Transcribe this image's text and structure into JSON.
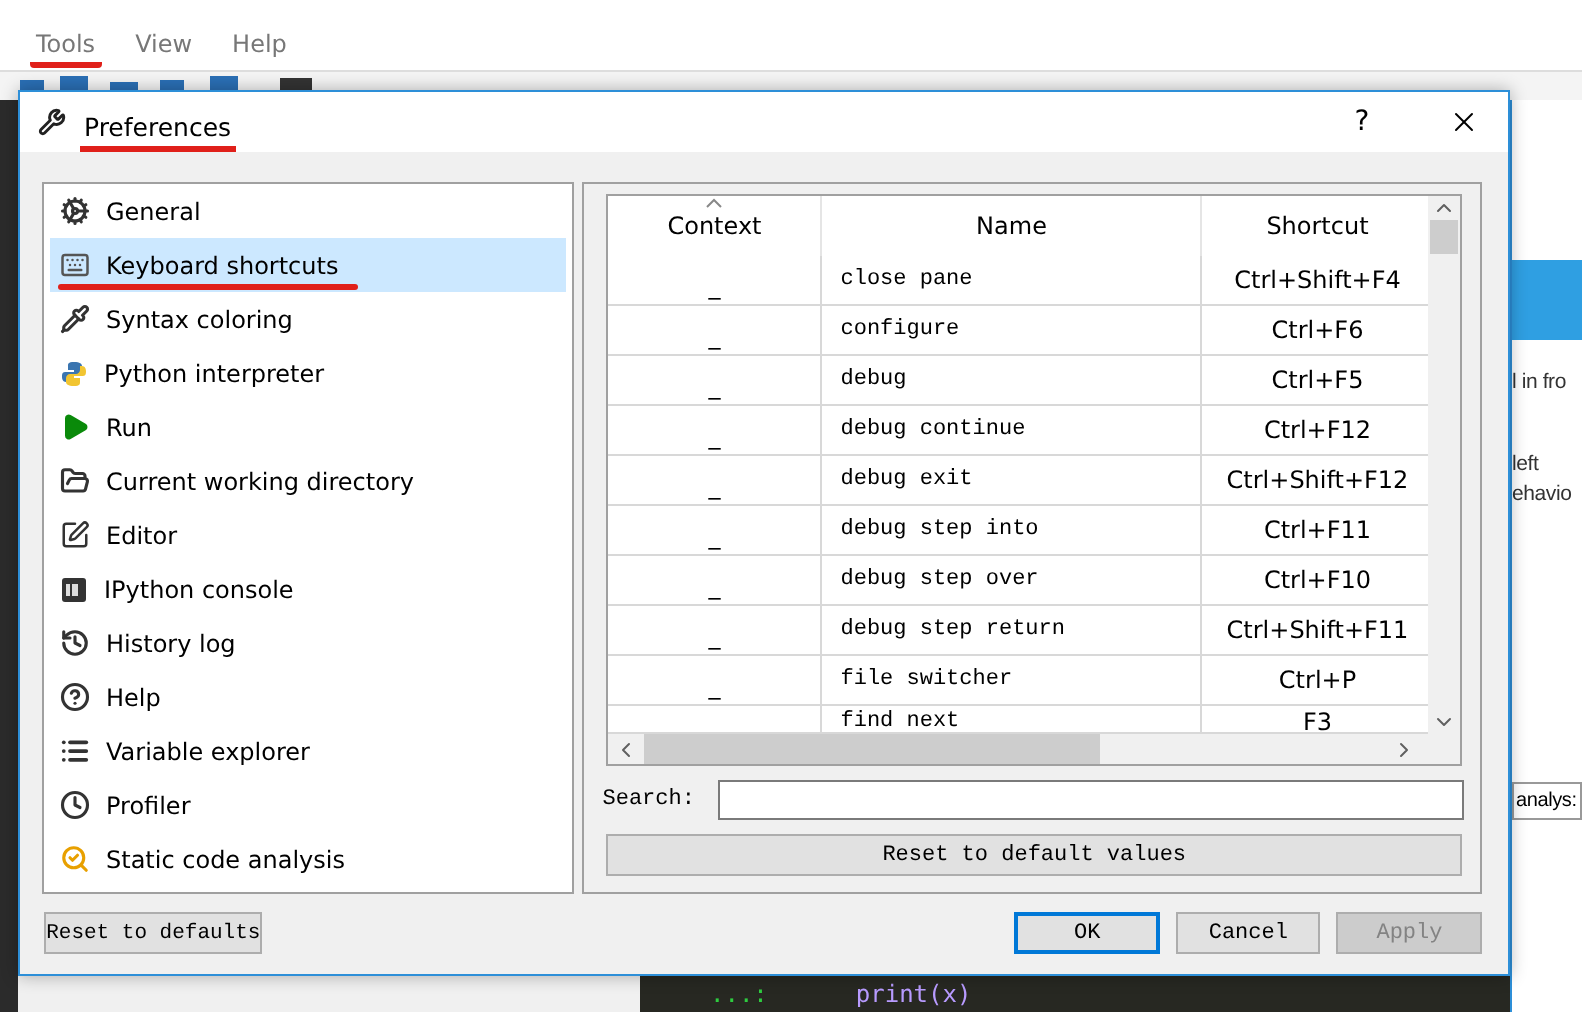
{
  "menu_bar": [
    {
      "label": "Tools",
      "annotated": true
    },
    {
      "label": "View",
      "annotated": false
    },
    {
      "label": "Help",
      "annotated": false
    }
  ],
  "dialog": {
    "title": "Preferences",
    "title_annotated": true,
    "help_button": "?",
    "sidebar": [
      {
        "label": "General",
        "selected": false,
        "annotated": false
      },
      {
        "label": "Keyboard shortcuts",
        "selected": true,
        "annotated": true
      },
      {
        "label": "Syntax coloring",
        "selected": false,
        "annotated": false
      },
      {
        "label": "Python interpreter",
        "selected": false,
        "annotated": false
      },
      {
        "label": "Run",
        "selected": false,
        "annotated": false
      },
      {
        "label": "Current working directory",
        "selected": false,
        "annotated": false
      },
      {
        "label": "Editor",
        "selected": false,
        "annotated": false
      },
      {
        "label": "IPython console",
        "selected": false,
        "annotated": false
      },
      {
        "label": "History log",
        "selected": false,
        "annotated": false
      },
      {
        "label": "Help",
        "selected": false,
        "annotated": false
      },
      {
        "label": "Variable explorer",
        "selected": false,
        "annotated": false
      },
      {
        "label": "Profiler",
        "selected": false,
        "annotated": false
      },
      {
        "label": "Static code analysis",
        "selected": false,
        "annotated": false
      }
    ],
    "shortcuts_table": {
      "columns": [
        "Context",
        "Name",
        "Shortcut"
      ],
      "rows": [
        {
          "context": "_",
          "name": "close pane",
          "shortcut": "Ctrl+Shift+F4"
        },
        {
          "context": "_",
          "name": "configure",
          "shortcut": "Ctrl+F6"
        },
        {
          "context": "_",
          "name": "debug",
          "shortcut": "Ctrl+F5"
        },
        {
          "context": "_",
          "name": "debug continue",
          "shortcut": "Ctrl+F12"
        },
        {
          "context": "_",
          "name": "debug exit",
          "shortcut": "Ctrl+Shift+F12"
        },
        {
          "context": "_",
          "name": "debug step into",
          "shortcut": "Ctrl+F11"
        },
        {
          "context": "_",
          "name": "debug step over",
          "shortcut": "Ctrl+F10"
        },
        {
          "context": "_",
          "name": "debug step return",
          "shortcut": "Ctrl+Shift+F11"
        },
        {
          "context": "_",
          "name": "file switcher",
          "shortcut": "Ctrl+P"
        },
        {
          "name": "find next",
          "shortcut": "F3"
        }
      ]
    },
    "search": {
      "label": "Search:"
    },
    "reset_values_button": "Reset to default values",
    "reset_defaults_button": "Reset to defaults",
    "buttons": [
      {
        "label": "OK",
        "default": true,
        "disabled": false
      },
      {
        "label": "Cancel",
        "default": false,
        "disabled": false
      },
      {
        "label": "Apply",
        "default": false,
        "disabled": true
      }
    ]
  },
  "background_app": {
    "side_texts": [
      "l in fro",
      "left",
      "ehavio"
    ],
    "field_text": "analys:",
    "console": [
      {
        "text": "...:",
        "kind": "prompt"
      },
      {
        "text": "print(x)",
        "kind": "code"
      }
    ]
  }
}
